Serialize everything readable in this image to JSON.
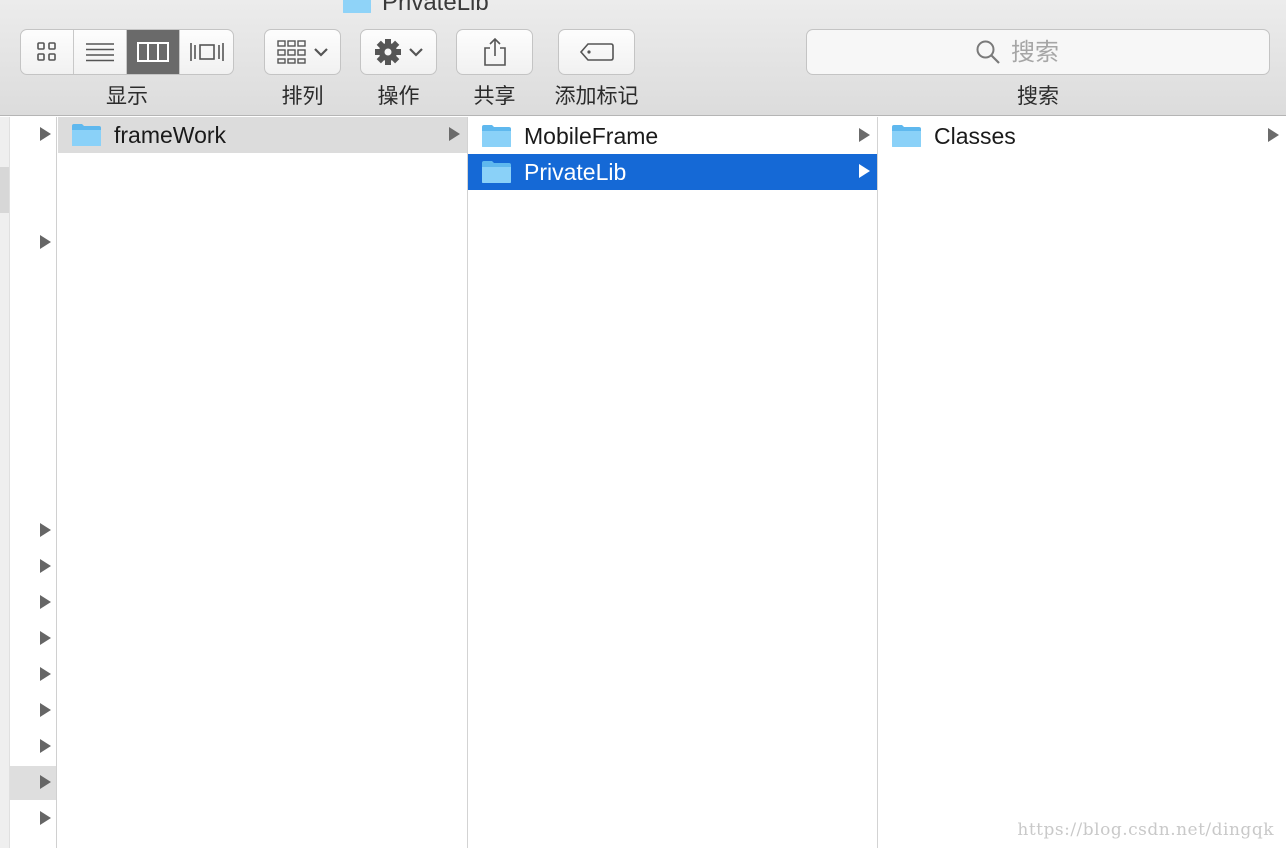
{
  "window": {
    "title": "PrivateLib"
  },
  "toolbar": {
    "view_label": "显示",
    "view_modes": [
      {
        "icon": "icon-view-grid-icon",
        "active": false
      },
      {
        "icon": "list-view-icon",
        "active": false
      },
      {
        "icon": "column-view-icon",
        "active": true
      },
      {
        "icon": "cover-flow-view-icon",
        "active": false
      }
    ],
    "arrange_label": "排列",
    "action_label": "操作",
    "share_label": "共享",
    "tags_label": "添加标记",
    "search_label": "搜索",
    "search_placeholder": "搜索"
  },
  "columns": [
    {
      "items": [
        {
          "name": "frameWork",
          "state": "selected-inactive",
          "has_children": true
        }
      ]
    },
    {
      "items": [
        {
          "name": "MobileFrame",
          "state": "normal",
          "has_children": true
        },
        {
          "name": "PrivateLib",
          "state": "selected-active",
          "has_children": true
        }
      ]
    },
    {
      "items": [
        {
          "name": "Classes",
          "state": "normal",
          "has_children": true
        }
      ]
    }
  ],
  "colors": {
    "selection_blue": "#1569d6",
    "selection_gray": "#dcdcdc",
    "folder_blue": "#6cc3f3"
  },
  "watermark": "https://blog.csdn.net/dingqk"
}
